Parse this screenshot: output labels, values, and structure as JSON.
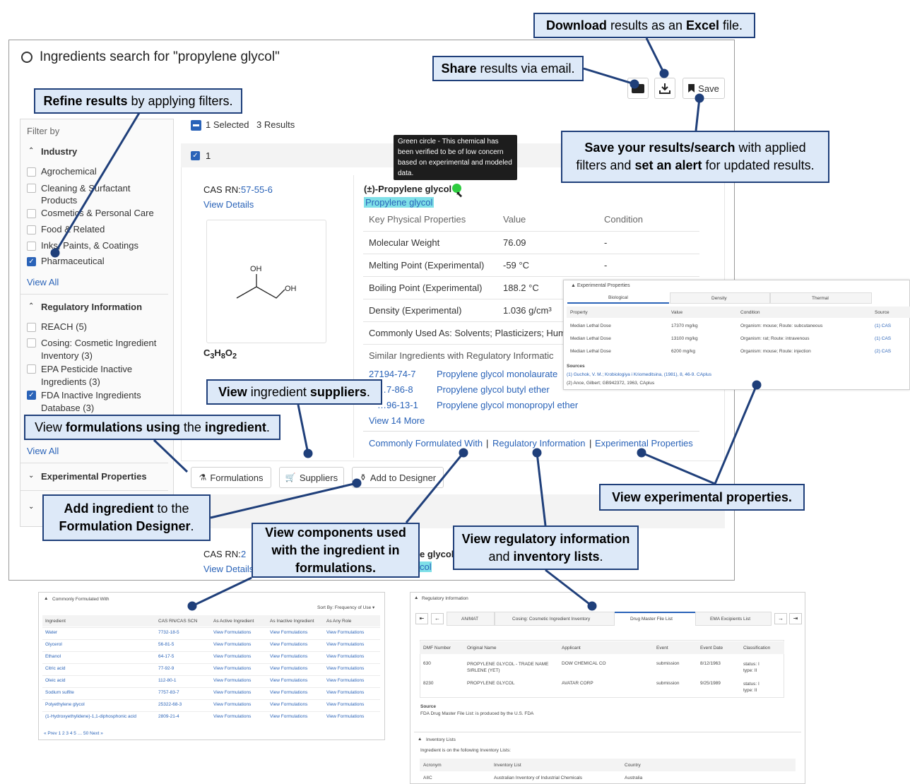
{
  "header": {
    "title": "Ingredients search for \"propylene glycol\"",
    "save_label": "Save"
  },
  "callouts": {
    "download": {
      "b1": "Download",
      "t1": " results as an ",
      "b2": "Excel",
      "t2": " file."
    },
    "share": {
      "b1": "Share",
      "t1": " results via email."
    },
    "refine": {
      "b1": "Refine results",
      "t1": " by applying filters."
    },
    "save": {
      "b1": "Save your results/search",
      "t1": " with applied filters and ",
      "b2": "set an alert",
      "t2": " for updated results."
    },
    "suppliers": {
      "b1": "View",
      "t1": " ingredient ",
      "b2": "suppliers",
      "t2": "."
    },
    "formulations": {
      "t1": "View ",
      "b1": "formulations using",
      "t2": " the ",
      "b2": "ingredient",
      "t3": "."
    },
    "designer": {
      "b1": "Add ingredient",
      "t1": " to the ",
      "b2": "Formulation Designer",
      "t2": "."
    },
    "components": {
      "b1": "View components used with the ingredient in formulations."
    },
    "regulatory": {
      "b1": "View regulatory information",
      "t1": " and ",
      "b2": "inventory lists",
      "t2": "."
    },
    "experimental": {
      "b1": "View experimental properties."
    }
  },
  "sidebar": {
    "filter_by": "Filter by",
    "industry": {
      "heading": "Industry",
      "items": [
        {
          "label": "Agrochemical",
          "checked": false
        },
        {
          "label": "Cleaning & Surfactant Products",
          "checked": false
        },
        {
          "label": "Cosmetics & Personal Care",
          "checked": false
        },
        {
          "label": "Food & Related",
          "checked": false
        },
        {
          "label": "Inks, Paints, & Coatings",
          "checked": false
        },
        {
          "label": "Pharmaceutical",
          "checked": true
        }
      ],
      "view_all": "View All"
    },
    "regulatory": {
      "heading": "Regulatory Information",
      "items": [
        {
          "label": "REACH (5)",
          "checked": false
        },
        {
          "label": "Cosing: Cosmetic Ingredient Inventory (3)",
          "checked": false
        },
        {
          "label": "EPA Pesticide Inactive Ingredients (3)",
          "checked": false
        },
        {
          "label": "FDA Inactive Ingredients Database (3)",
          "checked": true
        }
      ],
      "view_all": "View All"
    },
    "experimental_heading": "Experimental Properties"
  },
  "results": {
    "selected": "1 Selected",
    "count": "3 Results",
    "row_number": "1"
  },
  "tooltip": "Green circle - This chemical has been verified to be of low concern based on experimental and modeled data.",
  "result1": {
    "cas_label": "CAS RN:",
    "cas_value": "57-55-6",
    "view_details": "View Details",
    "structure_oh1": "OH",
    "structure_oh2": "OH",
    "formula": "C3H8O2",
    "name": "(±)-Propylene glycol",
    "synonym": "Propylene glycol",
    "table_headers": [
      "Key Physical Properties",
      "Value",
      "Condition"
    ],
    "properties": [
      {
        "name": "Molecular Weight",
        "value": "76.09",
        "condition": "-"
      },
      {
        "name": "Melting Point (Experimental)",
        "value": "-59 °C",
        "condition": "-"
      },
      {
        "name": "Boiling Point (Experimental)",
        "value": "188.2 °C",
        "condition": ""
      },
      {
        "name": "Density (Experimental)",
        "value": "1.036 g/cm³",
        "condition": ""
      }
    ],
    "commonly_used": "Commonly Used As:  Solvents; Plasticizers; Hum",
    "similar_heading": "Similar Ingredients with Regulatory Informatic",
    "similar": [
      {
        "cas": "27194-74-7",
        "name": "Propylene glycol monolaurate"
      },
      {
        "cas": "…7-86-8",
        "name": "Propylene glycol butyl ether"
      },
      {
        "cas": "…96-13-1",
        "name": "Propylene glycol monopropyl ether"
      }
    ],
    "view_more": "View 14 More",
    "links": [
      "Commonly Formulated With",
      "Regulatory Information",
      "Experimental Properties"
    ],
    "buttons": {
      "formulations": "Formulations",
      "suppliers": "Suppliers",
      "designer": "Add to Designer"
    }
  },
  "result2": {
    "cas_label": "CAS RN:",
    "cas_value": "2",
    "view_details": "View Details",
    "name_tail": "e glycol",
    "syn_tail": "col"
  },
  "exp_panel": {
    "title": "Experimental Properties",
    "tabs": [
      "Biological",
      "Density",
      "Thermal"
    ],
    "headers": [
      "Property",
      "Value",
      "Condition",
      "Source"
    ],
    "rows": [
      [
        "Median Lethal Dose",
        "17370 mg/kg",
        "Organism: mouse; Route: subcutaneous",
        "(1) CAS"
      ],
      [
        "Median Lethal Dose",
        "13100 mg/kg",
        "Organism: rat; Route: intravenous",
        "(1) CAS"
      ],
      [
        "Median Lethal Dose",
        "6200 mg/kg",
        "Organism: mouse; Route: injection",
        "(2) CAS"
      ]
    ],
    "sources_label": "Sources",
    "sources": [
      "(1) Guchok, V. M.; Krobiologiya i Kriomeditsina, (1981), 8, 46-9. CAplus",
      "(2) Ance, Gilbert; GB942372, 1963, CAplus"
    ]
  },
  "cfw_panel": {
    "title": "Commonly Formulated With",
    "sort": "Sort By: Frequency of Use ▾",
    "headers": [
      "Ingredient",
      "CAS RN/CAS SCN",
      "As Active Ingredient",
      "As Inactive Ingredient",
      "As Any Role"
    ],
    "rows": [
      [
        "Water",
        "7732-18-5"
      ],
      [
        "Glycerol",
        "56-81-5"
      ],
      [
        "Ethanol",
        "64-17-5"
      ],
      [
        "Citric acid",
        "77-92-9"
      ],
      [
        "Oleic acid",
        "112-80-1"
      ],
      [
        "Sodium sulfite",
        "7757-83-7"
      ],
      [
        "Polyethylene glycol",
        "25322-68-3"
      ],
      [
        "(1-Hydroxyethylidene)-1,1-diphosphonic acid",
        "2809-21-4"
      ]
    ],
    "view_link": "View Formulations",
    "pagination": "« Prev   1   2   3   4   5   …   50   Next »"
  },
  "reg_panel": {
    "title": "Regulatory Information",
    "tabs": [
      "AN/MAT",
      "Cosing: Cosmetic Ingredient Inventory",
      "Drug Master File List",
      "EMA Excipients List"
    ],
    "headers": [
      "DMF Number",
      "Original Name",
      "Applicant",
      "Event",
      "Event Date",
      "Classification"
    ],
    "rows": [
      [
        "630",
        "PROPYLENE GLYCOL - TRADE NAME SIRLENE (YET)",
        "DOW CHEMICAL CO",
        "submission",
        "8/12/1963",
        "status: I type: II"
      ],
      [
        "8230",
        "PROPYLENE GLYCOL",
        "AVATAR CORP",
        "submission",
        "9/25/1989",
        "status: I type: II"
      ]
    ],
    "source_label": "Source",
    "source_text": "FDA Drug Master File List: is produced by the U.S. FDA",
    "inventory_title": "Inventory Lists",
    "inventory_sub": "Ingredient is on the following Inventory Lists:",
    "inv_headers": [
      "Acronym",
      "Inventory List",
      "Country"
    ],
    "inv_row": [
      "AIIC",
      "Australian Inventory of Industrial Chemicals",
      "Australia"
    ]
  }
}
